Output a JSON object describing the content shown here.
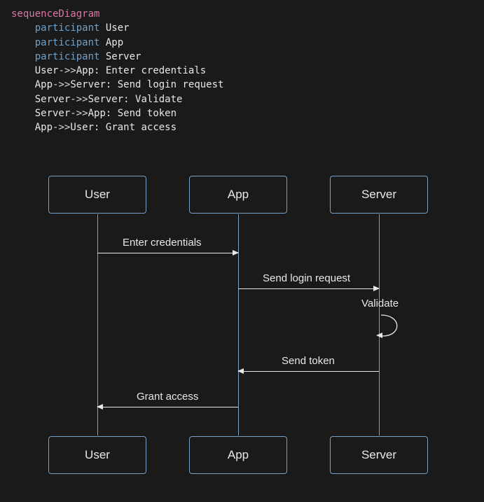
{
  "code": {
    "diagram_keyword": "sequenceDiagram",
    "participant_keyword": "participant",
    "arrow": "->>",
    "colon": ": ",
    "participants": [
      "User",
      "App",
      "Server"
    ],
    "lines": [
      {
        "from": "User",
        "to": "App",
        "text": "Enter credentials"
      },
      {
        "from": "App",
        "to": "Server",
        "text": "Send login request"
      },
      {
        "from": "Server",
        "to": "Server",
        "text": "Validate"
      },
      {
        "from": "Server",
        "to": "App",
        "text": "Send token"
      },
      {
        "from": "App",
        "to": "User",
        "text": "Grant access"
      }
    ]
  },
  "diagram": {
    "actors": {
      "user": "User",
      "app": "App",
      "server": "Server"
    },
    "messages": {
      "m1": "Enter credentials",
      "m2": "Send login request",
      "m3": "Validate",
      "m4": "Send token",
      "m5": "Grant access"
    }
  }
}
